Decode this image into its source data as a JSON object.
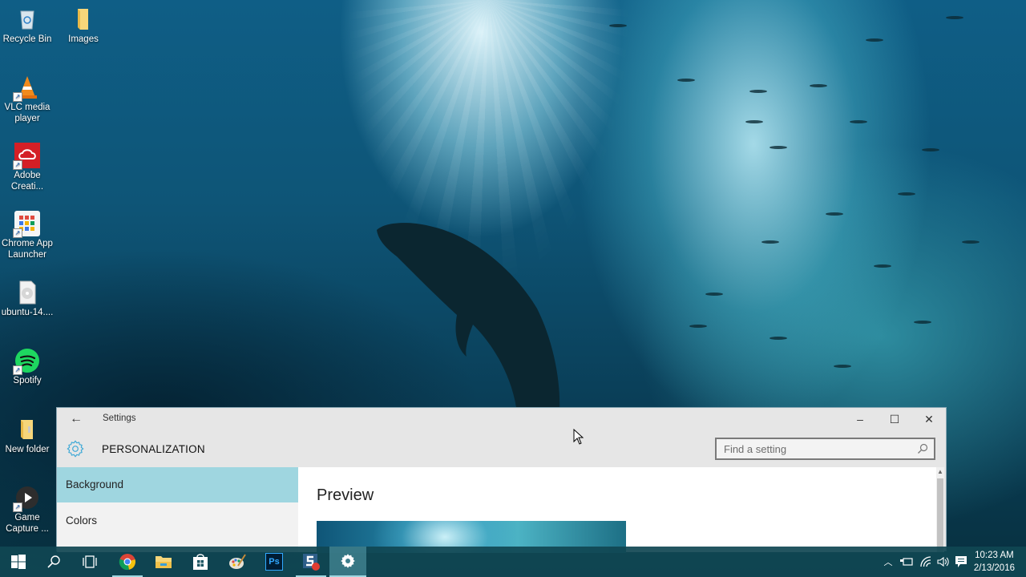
{
  "desktop": {
    "icons": [
      {
        "label": "Recycle Bin",
        "icon": "recycle-bin-icon"
      },
      {
        "label": "Images",
        "icon": "folder-icon"
      },
      {
        "label": "VLC media player",
        "icon": "vlc-icon"
      },
      {
        "label": "Adobe Creati...",
        "icon": "adobe-creative-cloud-icon"
      },
      {
        "label": "Chrome App Launcher",
        "icon": "chrome-app-launcher-icon"
      },
      {
        "label": "ubuntu-14....",
        "icon": "disc-image-icon"
      },
      {
        "label": "Spotify",
        "icon": "spotify-icon"
      },
      {
        "label": "New folder",
        "icon": "folder-icon"
      },
      {
        "label": "Game Capture ...",
        "icon": "game-capture-icon"
      }
    ]
  },
  "settings_window": {
    "title": "Settings",
    "section": "PERSONALIZATION",
    "search": {
      "placeholder": "Find a setting",
      "value": ""
    },
    "controls": {
      "minimize": "–",
      "maximize": "☐",
      "close": "✕"
    },
    "nav": [
      {
        "label": "Background",
        "active": true
      },
      {
        "label": "Colors",
        "active": false
      }
    ],
    "content": {
      "heading": "Preview"
    }
  },
  "taskbar": {
    "apps": [
      {
        "name": "start",
        "icon": "windows-logo-icon"
      },
      {
        "name": "search",
        "icon": "search-icon"
      },
      {
        "name": "task-view",
        "icon": "task-view-icon"
      },
      {
        "name": "chrome",
        "icon": "chrome-icon"
      },
      {
        "name": "file-explorer",
        "icon": "file-explorer-icon"
      },
      {
        "name": "store",
        "icon": "store-icon"
      },
      {
        "name": "paint",
        "icon": "paint-icon"
      },
      {
        "name": "photoshop",
        "icon": "photoshop-icon",
        "label": "Ps"
      },
      {
        "name": "snagit",
        "icon": "snagit-icon"
      },
      {
        "name": "settings",
        "icon": "gear-icon",
        "active": true
      }
    ],
    "tray": {
      "time": "10:23 AM",
      "date": "2/13/2016"
    }
  },
  "colors": {
    "accent": "#9fd6e0",
    "taskbar": "#104652",
    "window_bg": "#e6e6e6"
  }
}
